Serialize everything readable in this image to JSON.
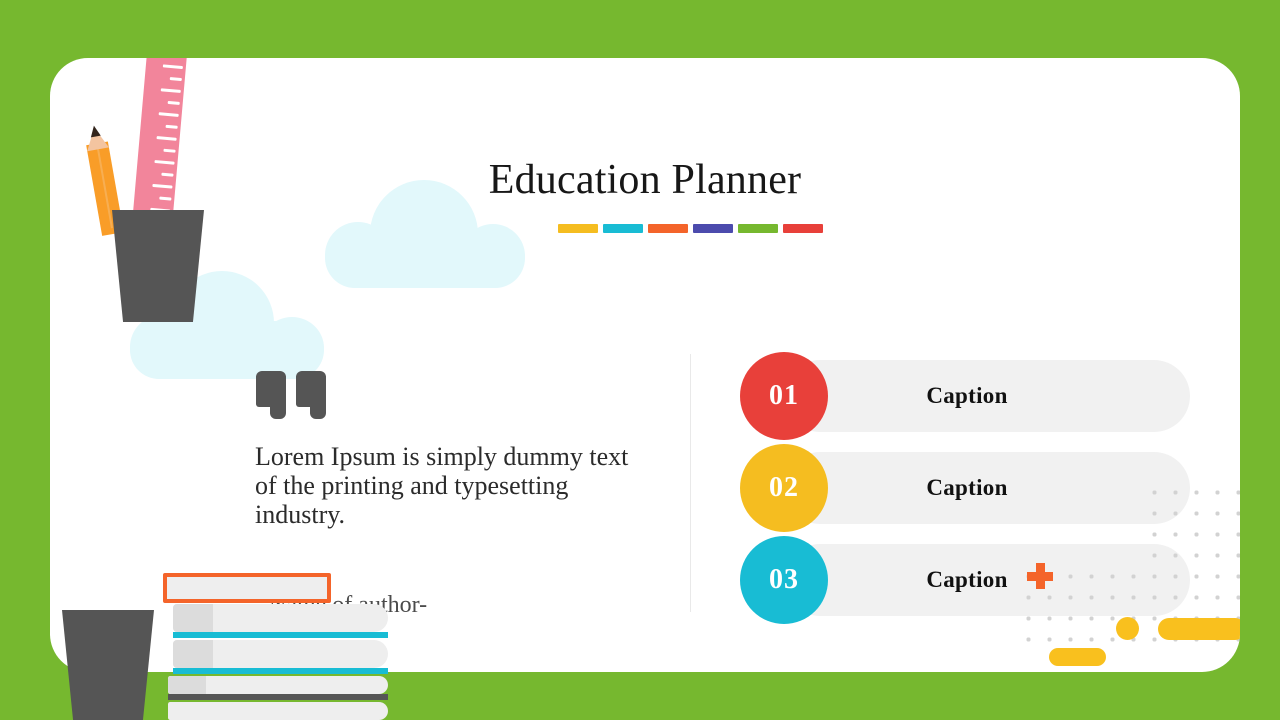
{
  "slide": {
    "background_color": "#76b82f",
    "card_color": "#ffffff",
    "title": "Education Planner"
  },
  "accent_bars": [
    {
      "name": "bar-yellow",
      "color": "#f5bd20"
    },
    {
      "name": "bar-cyan",
      "color": "#18bcd4"
    },
    {
      "name": "bar-orange",
      "color": "#f4642a"
    },
    {
      "name": "bar-purple",
      "color": "#4c4bad"
    },
    {
      "name": "bar-green",
      "color": "#76b82f"
    },
    {
      "name": "bar-red",
      "color": "#e8403a"
    }
  ],
  "quote": {
    "text": "Lorem Ipsum is simply dummy text of the printing and typesetting industry.",
    "author": "- Name of author-",
    "mark_color": "#555555"
  },
  "captions": [
    {
      "number": "01",
      "label": "Caption",
      "color": "#e8403a"
    },
    {
      "number": "02",
      "label": "Caption",
      "color": "#f5bd20"
    },
    {
      "number": "03",
      "label": "Caption",
      "color": "#18bcd4"
    }
  ],
  "decorations": {
    "cloud_color": "#e2f8fb",
    "dot_color": "#d2d2d2",
    "cross_color": "#f4642a",
    "yellow_shape_color": "#f9c01e",
    "ruler_color": "#f2859b",
    "pencil_color": "#f99d28",
    "cup_color": "#555555",
    "book_page_color": "#eeeeee",
    "book_spine_cyan": "#18bcd4",
    "book_spine_dark": "#555555",
    "book_outline_orange": "#f4642a"
  }
}
